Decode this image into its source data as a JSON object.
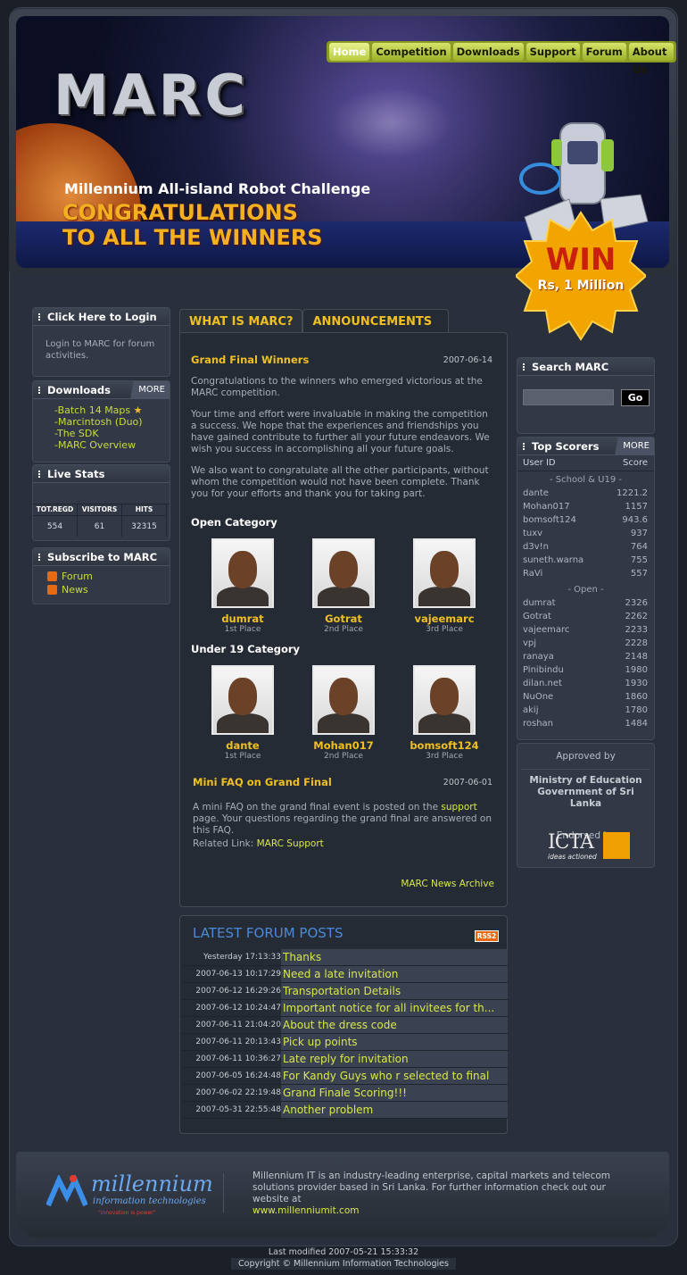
{
  "header": {
    "logo_text": "MARC",
    "tagline": "Millennium All-island Robot Challenge",
    "headline": "CONGRATULATIONS TO ALL THE WINNERS",
    "badge_line1": "WIN",
    "badge_line2": "Rs, 1 Million",
    "nav": [
      "Home",
      "Competition",
      "Downloads",
      "Support",
      "Forum",
      "About Us"
    ]
  },
  "login_box": {
    "title": "Click Here to Login",
    "text": "Login to MARC for forum activities."
  },
  "downloads_box": {
    "title": "Downloads",
    "more": "MORE",
    "items": [
      "Batch 14 Maps",
      "Marcintosh (Duo)",
      "The SDK",
      "MARC Overview"
    ]
  },
  "live_stats": {
    "title": "Live Stats",
    "headers": [
      "TOT.REGD",
      "VISITORS",
      "HITS"
    ],
    "values": [
      "554",
      "61",
      "32315"
    ]
  },
  "subscribe_box": {
    "title": "Subscribe to MARC",
    "items": [
      "Forum",
      "News"
    ]
  },
  "tabs": [
    "WHAT IS MARC?",
    "ANNOUNCEMENTS"
  ],
  "news": [
    {
      "title": "Grand Final Winners",
      "date": "2007-06-14",
      "paragraphs": [
        "Congratulations to the winners who emerged victorious at the MARC competition.",
        "Your time and effort were invaluable in making the competition a success. We hope that the experiences and friendships you have gained contribute to further all your future endeavors.  We wish you success in accomplishing all your future goals.",
        "We also want to congratulate all the other participants, without whom the competition would not have been complete. Thank you for your efforts and thank you for taking part."
      ]
    }
  ],
  "open_category": {
    "title": "Open Category",
    "winners": [
      {
        "name": "dumrat",
        "place": "1st Place"
      },
      {
        "name": "Gotrat",
        "place": "2nd Place"
      },
      {
        "name": "vajeemarc",
        "place": "3rd Place"
      }
    ]
  },
  "u19_category": {
    "title": "Under 19 Category",
    "winners": [
      {
        "name": "dante",
        "place": "1st Place"
      },
      {
        "name": "Mohan017",
        "place": "2nd Place"
      },
      {
        "name": "bomsoft124",
        "place": "3rd Place"
      }
    ]
  },
  "faq": {
    "title": "Mini FAQ on Grand Final",
    "date": "2007-06-01",
    "text_before": "A mini FAQ on the grand final event is posted on the ",
    "link": "support",
    "text_after": " page. Your questions regarding the grand final are answered on this FAQ.",
    "related_label": "Related Link: ",
    "related_link": "MARC Support"
  },
  "archive_link": "MARC News Archive",
  "forum": {
    "title": "LATEST FORUM POSTS",
    "rss": "RSS2",
    "posts": [
      {
        "date": "Yesterday 17:13:33",
        "topic": "Thanks"
      },
      {
        "date": "2007-06-13 10:17:29",
        "topic": "Need a late invitation"
      },
      {
        "date": "2007-06-12 16:29:26",
        "topic": "Transportation Details"
      },
      {
        "date": "2007-06-12 10:24:47",
        "topic": "Important notice for all invitees for th..."
      },
      {
        "date": "2007-06-11 21:04:20",
        "topic": "About the dress code"
      },
      {
        "date": "2007-06-11 20:13:43",
        "topic": "Pick up points"
      },
      {
        "date": "2007-06-11 10:36:27",
        "topic": "Late reply for invitation"
      },
      {
        "date": "2007-06-05 16:24:48",
        "topic": "For Kandy Guys who r selected to final"
      },
      {
        "date": "2007-06-02 22:19:48",
        "topic": "Grand Finale Scoring!!!"
      },
      {
        "date": "2007-05-31 22:55:48",
        "topic": "Another problem"
      }
    ]
  },
  "search_box": {
    "title": "Search MARC",
    "button": "Go",
    "value": ""
  },
  "top_scorers": {
    "title": "Top Scorers",
    "more": "MORE",
    "col_user": "User ID",
    "col_score": "Score",
    "school_label": "- School & U19 -",
    "school": [
      {
        "user": "dante",
        "score": "1221.2"
      },
      {
        "user": "Mohan017",
        "score": "1157"
      },
      {
        "user": "bomsoft124",
        "score": "943.6"
      },
      {
        "user": "tuxv",
        "score": "937"
      },
      {
        "user": "d3v!n",
        "score": "764"
      },
      {
        "user": "suneth.warna",
        "score": "755"
      },
      {
        "user": "RaVi",
        "score": "557"
      }
    ],
    "open_label": "- Open -",
    "open": [
      {
        "user": "dumrat",
        "score": "2326"
      },
      {
        "user": "Gotrat",
        "score": "2262"
      },
      {
        "user": "vajeemarc",
        "score": "2233"
      },
      {
        "user": "vpj",
        "score": "2228"
      },
      {
        "user": "ranaya",
        "score": "2148"
      },
      {
        "user": "Pinibindu",
        "score": "1980"
      },
      {
        "user": "dilan.net",
        "score": "1930"
      },
      {
        "user": "NuOne",
        "score": "1860"
      },
      {
        "user": "akij",
        "score": "1780"
      },
      {
        "user": "roshan",
        "score": "1484"
      }
    ]
  },
  "approval": {
    "approved_by": "Approved by",
    "ministry": "Ministry of Education Government of Sri Lanka",
    "endorsed_by": "Endorsed by",
    "icta": "ICTA",
    "icta_tag": "ideas actioned"
  },
  "footer": {
    "brand": "millennium",
    "brand_sub": "information technologies",
    "brand_tag": "\"innovation is power\"",
    "about": "Millennium IT is an industry-leading enterprise, capital markets and telecom solutions provider based in Sri Lanka. For further information check out our website at",
    "url": "www.millenniumit.com",
    "modified": "Last modified 2007-05-21 15:33:32",
    "copyright": "Copyright © Millennium Information Technologies"
  }
}
